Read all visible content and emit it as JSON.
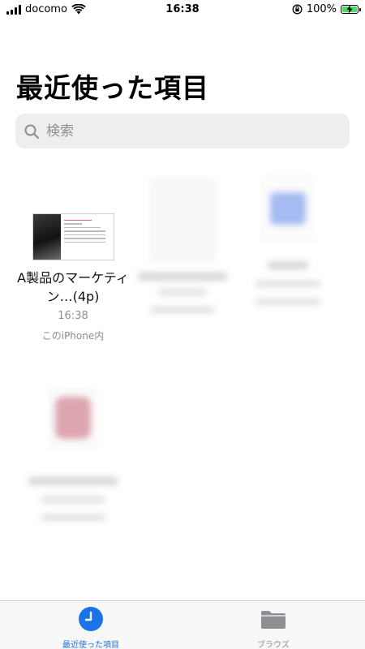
{
  "status_bar": {
    "carrier": "docomo",
    "time": "16:38",
    "battery_percent": "100%",
    "battery_level": 1.0
  },
  "page": {
    "title": "最近使った項目"
  },
  "search": {
    "placeholder": "検索"
  },
  "files": [
    {
      "name": "A製品のマーケティン…(4p)",
      "time": "16:38",
      "location": "このiPhone内",
      "icon": "document-thumbnail"
    }
  ],
  "tab_bar": {
    "recent_label": "最近使った項目",
    "browse_label": "ブラウズ",
    "accent_color": "#1a73e8"
  }
}
